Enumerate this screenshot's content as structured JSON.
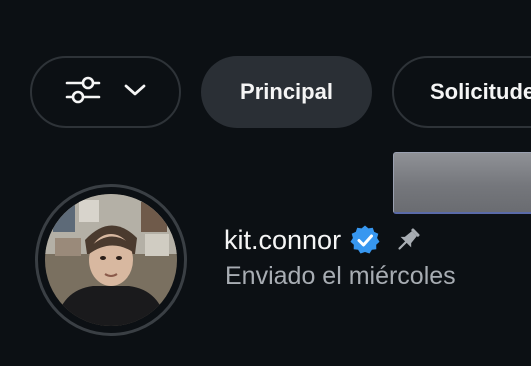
{
  "filters": {
    "filter_icon": "sliders-icon",
    "chevron_icon": "chevron-down-icon",
    "tabs": [
      {
        "label": "Principal",
        "selected": true
      },
      {
        "label": "Solicitudes",
        "selected": false
      }
    ]
  },
  "conversation": {
    "username": "kit.connor",
    "verified_icon": "verified-badge-icon",
    "pinned_icon": "pin-icon",
    "subtitle": "Enviado el miércoles"
  },
  "colors": {
    "background": "#0c1014",
    "chip_selected": "#2a2f35",
    "chip_border": "#2e3338",
    "verified_blue": "#3797f0",
    "muted_text": "#a8adb3"
  }
}
